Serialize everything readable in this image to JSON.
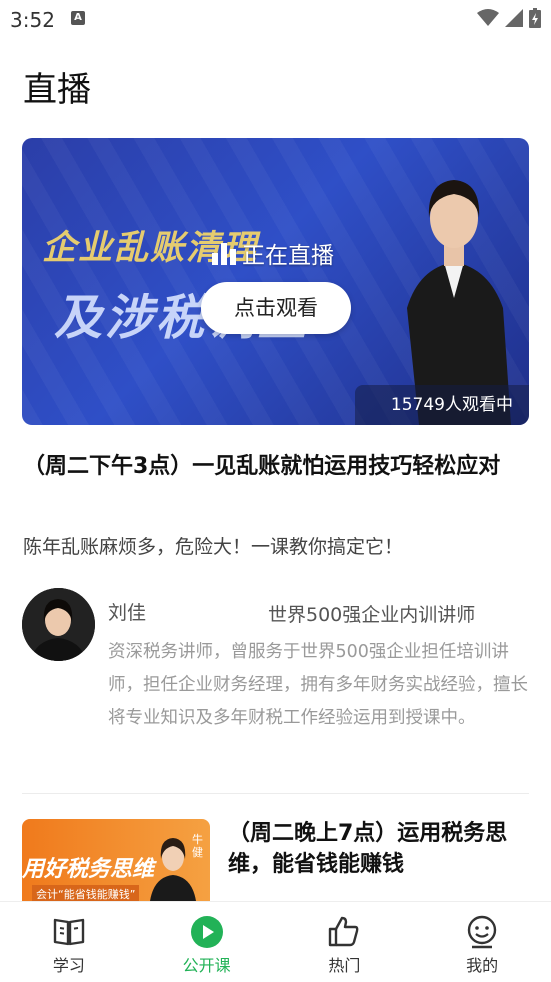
{
  "status_bar": {
    "time": "3:52",
    "notification_letter": "A",
    "icons": [
      "wifi-icon",
      "signal-icon",
      "battery-charging-icon"
    ]
  },
  "page": {
    "title": "直播"
  },
  "live_banner": {
    "banner_text_line1": "企业乱账清理",
    "banner_text_line2": "及涉税调整",
    "live_status": "正在直播",
    "watch_button": "点击观看",
    "viewers": "15749人观看中"
  },
  "course": {
    "title": "（周二下午3点）一见乱账就怕运用技巧轻松应对",
    "subtitle": "陈年乱账麻烦多，危险大！一课教你搞定它！",
    "teacher": {
      "name": "刘佳",
      "title": "世界500强企业内训讲师",
      "bio": "资深税务讲师，曾服务于世界500强企业担任培训讲师，担任企业财务经理，拥有多年财务实战经验，擅长将专业知识及多年财税工作经验运用到授课中。"
    }
  },
  "next_course": {
    "thumb_title": "用好税务思维",
    "thumb_sub": "会计“能省钱能赚钱”",
    "thumb_side": "牛健",
    "title": "（周二晚上7点）运用税务思维，能省钱能赚钱"
  },
  "tabbar": {
    "tabs": [
      {
        "label": "学习",
        "icon": "book-icon"
      },
      {
        "label": "公开课",
        "icon": "play-circle-icon"
      },
      {
        "label": "热门",
        "icon": "thumbs-up-icon"
      },
      {
        "label": "我的",
        "icon": "smiley-face-icon"
      }
    ],
    "active_color": "#22b257"
  }
}
